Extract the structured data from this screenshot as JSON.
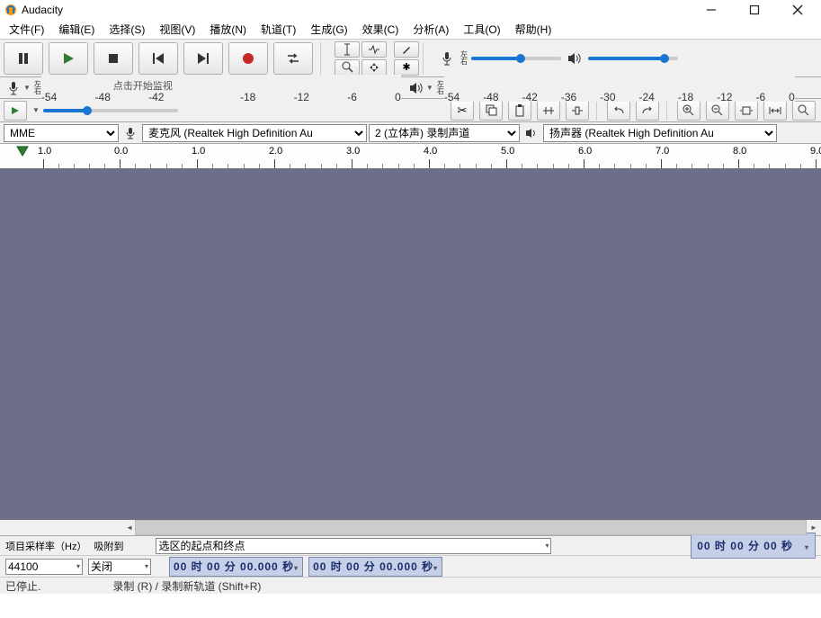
{
  "window": {
    "title": "Audacity"
  },
  "menu": [
    "文件(F)",
    "编辑(E)",
    "选择(S)",
    "视图(V)",
    "播放(N)",
    "轨道(T)",
    "生成(G)",
    "效果(C)",
    "分析(A)",
    "工具(O)",
    "帮助(H)"
  ],
  "meter": {
    "rec_ticks": [
      "-54",
      "-48",
      "-42",
      "点击开始监视",
      "-18",
      "-12",
      "-6",
      "0"
    ],
    "play_ticks": [
      "-54",
      "-48",
      "-42",
      "-36",
      "-30",
      "-24",
      "-18",
      "-12",
      "-6",
      "0"
    ],
    "lr": "左\n右"
  },
  "devices": {
    "host": "MME",
    "rec": "麦克风 (Realtek High Definition Au",
    "channels": "2 (立体声) 录制声道",
    "play": "扬声器 (Realtek High Definition Au"
  },
  "ruler": {
    "labels": [
      "1.0",
      "0.0",
      "1.0",
      "2.0",
      "3.0",
      "4.0",
      "5.0",
      "6.0",
      "7.0",
      "8.0",
      "9.0"
    ],
    "positions": [
      48,
      133,
      219,
      305,
      391,
      477,
      563,
      649,
      735,
      821,
      907
    ]
  },
  "status": {
    "rate_label": "项目采样率（Hz）",
    "rate_value": "44100",
    "snap_label": "吸附到",
    "snap_value": "关闭",
    "sel_label": "选区的起点和终点",
    "time1": "00 时 00 分 00.000 秒",
    "time2": "00 时 00 分 00.000 秒",
    "bigtime": "00 时 00 分 00 秒"
  },
  "footer": {
    "left": "已停止.",
    "right": "录制 (R) / 录制新轨道 (Shift+R)"
  }
}
